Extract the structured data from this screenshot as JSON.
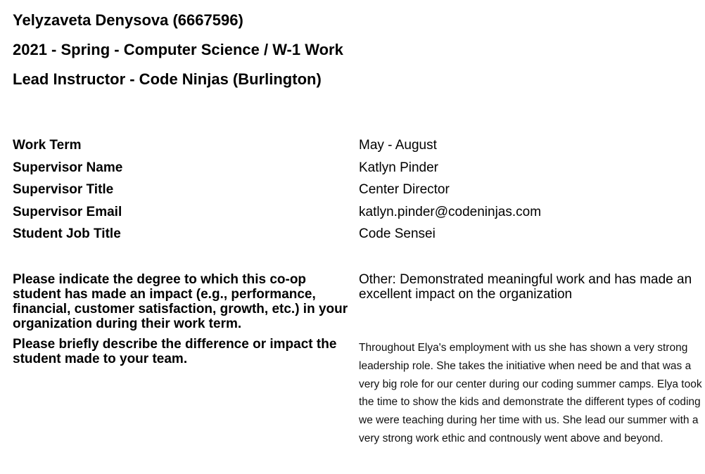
{
  "header": {
    "student": "Yelyzaveta Denysova (6667596)",
    "term": "2021 - Spring - Computer Science / W-1 Work",
    "position": "Lead Instructor - Code Ninjas (Burlington)"
  },
  "fields": [
    {
      "label": "Work Term",
      "value": "May - August"
    },
    {
      "label": "Supervisor Name",
      "value": "Katlyn Pinder"
    },
    {
      "label": "Supervisor Title",
      "value": "Center Director"
    },
    {
      "label": "Supervisor Email",
      "value": "katlyn.pinder@codeninjas.com"
    },
    {
      "label": "Student Job Title",
      "value": "Code Sensei"
    }
  ],
  "questions": [
    {
      "label": "Please indicate the degree to which this co-op student has made an impact (e.g., performance, financial, customer satisfaction, growth, etc.) in your organization during their work term.",
      "answer": "Other: Demonstrated meaningful work and has made an excellent impact on the organization"
    },
    {
      "label": "Please briefly describe the difference or impact the student made to your team.",
      "answer": "Throughout Elya's employment with us she has shown a very strong leadership role. She takes the initiative when need be and that was a very big role for our center during our coding summer camps. Elya took the time to show the kids and demonstrate the different types of coding we were teaching during her time with us. She lead our summer with a very strong work ethic and contnously went above and beyond."
    }
  ]
}
